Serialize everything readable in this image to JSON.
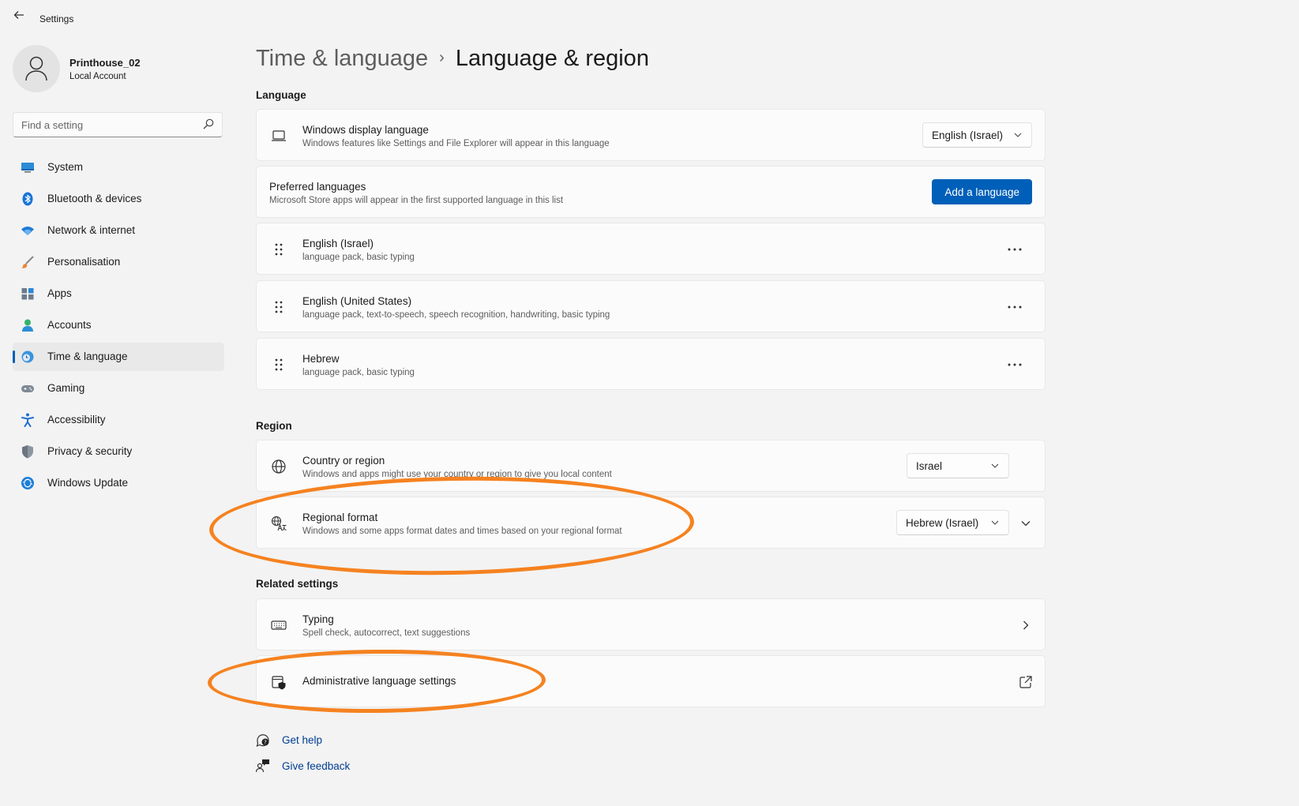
{
  "app": {
    "title": "Settings"
  },
  "profile": {
    "name": "Printhouse_02",
    "account_type": "Local Account"
  },
  "search": {
    "placeholder": "Find a setting"
  },
  "sidebar": {
    "items": [
      {
        "label": "System",
        "icon": "system-icon"
      },
      {
        "label": "Bluetooth & devices",
        "icon": "bluetooth-icon"
      },
      {
        "label": "Network & internet",
        "icon": "wifi-icon"
      },
      {
        "label": "Personalisation",
        "icon": "brush-icon"
      },
      {
        "label": "Apps",
        "icon": "apps-icon"
      },
      {
        "label": "Accounts",
        "icon": "accounts-icon"
      },
      {
        "label": "Time & language",
        "icon": "time-language-icon",
        "active": true
      },
      {
        "label": "Gaming",
        "icon": "gaming-icon"
      },
      {
        "label": "Accessibility",
        "icon": "accessibility-icon"
      },
      {
        "label": "Privacy & security",
        "icon": "shield-icon"
      },
      {
        "label": "Windows Update",
        "icon": "update-icon"
      }
    ]
  },
  "breadcrumb": {
    "parent": "Time & language",
    "separator": "›",
    "current": "Language & region"
  },
  "language": {
    "section_title": "Language",
    "display": {
      "title": "Windows display language",
      "subtitle": "Windows features like Settings and File Explorer will appear in this language",
      "value": "English (Israel)"
    },
    "preferred": {
      "title": "Preferred languages",
      "subtitle": "Microsoft Store apps will appear in the first supported language in this list",
      "button": "Add a language"
    },
    "list": [
      {
        "name": "English (Israel)",
        "features": "language pack, basic typing"
      },
      {
        "name": "English (United States)",
        "features": "language pack, text-to-speech, speech recognition, handwriting, basic typing"
      },
      {
        "name": "Hebrew",
        "features": "language pack, basic typing"
      }
    ]
  },
  "region": {
    "section_title": "Region",
    "country": {
      "title": "Country or region",
      "subtitle": "Windows and apps might use your country or region to give you local content",
      "value": "Israel"
    },
    "format": {
      "title": "Regional format",
      "subtitle": "Windows and some apps format dates and times based on your regional format",
      "value": "Hebrew (Israel)"
    }
  },
  "related": {
    "section_title": "Related settings",
    "typing": {
      "title": "Typing",
      "subtitle": "Spell check, autocorrect, text suggestions"
    },
    "admin": {
      "title": "Administrative language settings"
    }
  },
  "help": {
    "get_help": "Get help",
    "give_feedback": "Give feedback"
  },
  "colors": {
    "accent": "#005fb8",
    "annotation": "#f58220",
    "background": "#f3f3f3",
    "card": "#fbfbfb"
  }
}
